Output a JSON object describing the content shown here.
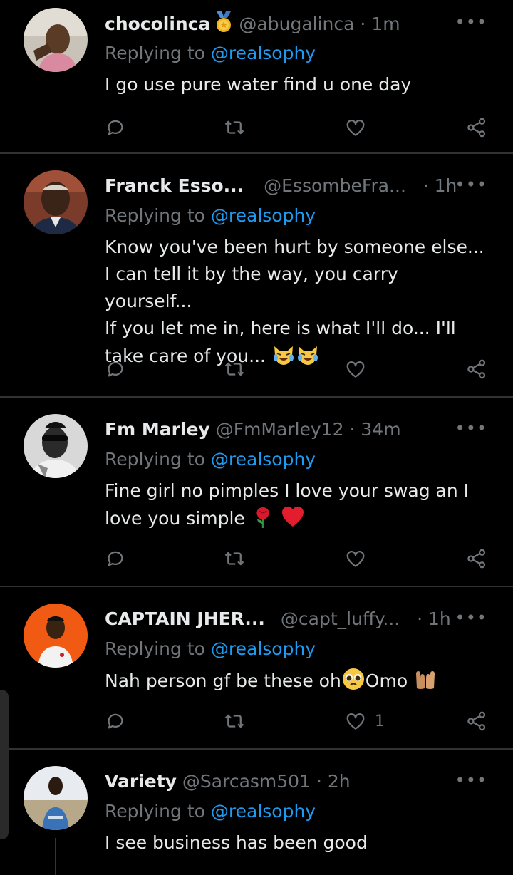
{
  "tweets": [
    {
      "name": "chocolinca",
      "handle": "@abugalinca",
      "time": "1m",
      "replying_prefix": "Replying to ",
      "mention": "@realsophy",
      "text": "I go use pure water find u one day",
      "likes": ""
    },
    {
      "name": "Franck Esso...",
      "handle": "@EssombeFra...",
      "time": "1h",
      "replying_prefix": "Replying to ",
      "mention": "@realsophy",
      "text_lines": [
        "Know you've been hurt by someone else...",
        "I can tell it by the way, you carry yourself...",
        "If you let me in, here is what I'll do... I'll",
        "take care of you..."
      ],
      "likes": ""
    },
    {
      "name": "Fm Marley",
      "handle": "@FmMarley12",
      "time": "34m",
      "replying_prefix": "Replying to ",
      "mention": "@realsophy",
      "text_lines": [
        "Fine girl no pimples I love your swag an I",
        "love you simple"
      ],
      "likes": ""
    },
    {
      "name": "CAPTAIN JHER...",
      "handle": "@capt_luffy...",
      "time": "1h",
      "replying_prefix": "Replying to ",
      "mention": "@realsophy",
      "text_a": "Nah person gf be these oh",
      "text_b": "Omo",
      "likes": "1"
    },
    {
      "name": "Variety",
      "handle": "@Sarcasm501",
      "time": "2h",
      "replying_prefix": "Replying to ",
      "mention": "@realsophy",
      "text": "I see business has been good",
      "likes": ""
    }
  ],
  "separator": "·",
  "more_glyph": "•••",
  "colors": {
    "background": "#000000",
    "text_primary": "#e7e9ea",
    "text_secondary": "#71767b",
    "accent": "#1d9bf0",
    "divider": "#2f3336"
  },
  "icons": [
    "reply-icon",
    "retweet-icon",
    "like-icon",
    "share-icon",
    "more-icon",
    "gold-medal-badge-icon"
  ]
}
